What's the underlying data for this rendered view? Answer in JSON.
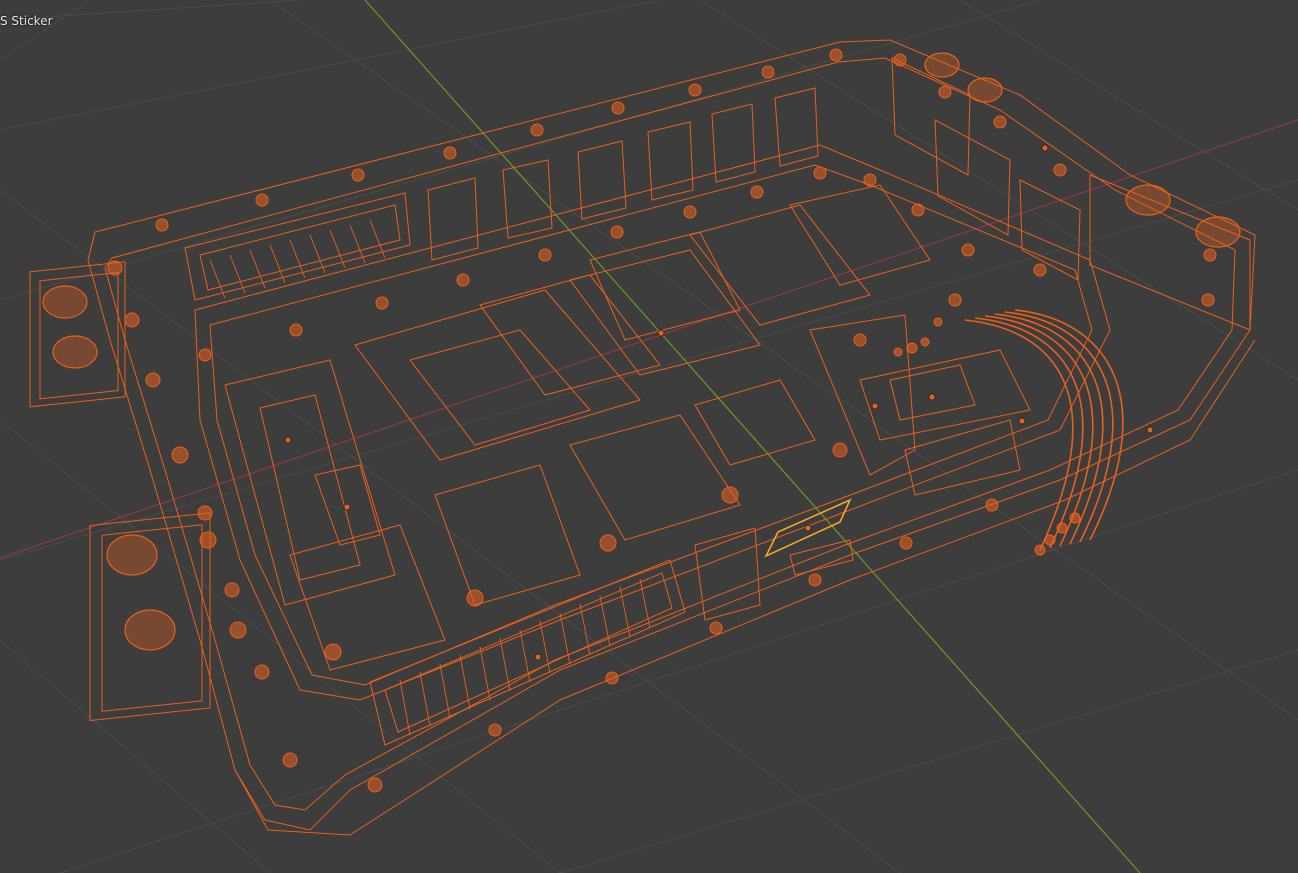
{
  "viewport": {
    "active_object_label": "S Sticker",
    "shading_mode": "wireframe",
    "selection_color": "#e8601c",
    "active_color": "#f5a623",
    "background_color": "#3d3d3d",
    "grid_color": "#4d4d4d",
    "x_axis_color": "#9b3b47",
    "y_axis_color": "#6b9a2a"
  }
}
